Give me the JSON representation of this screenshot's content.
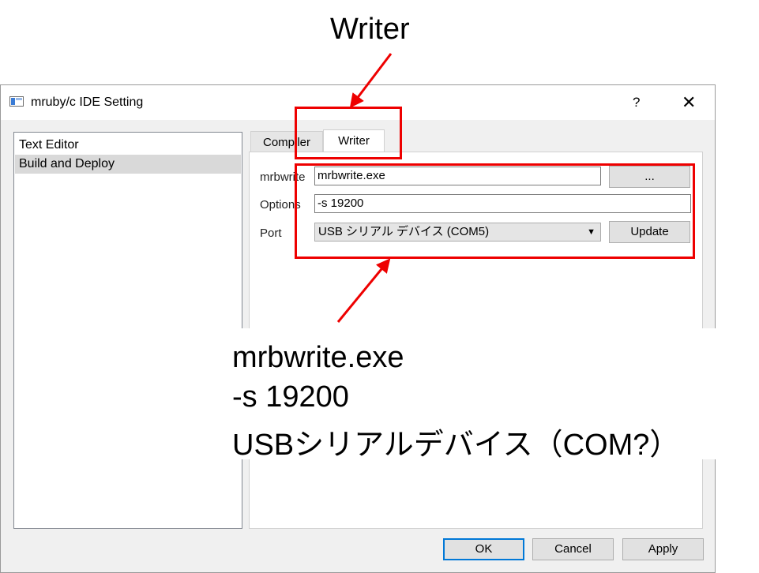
{
  "annotation": {
    "title": "Writer",
    "lines": [
      "mrbwrite.exe",
      "-s 19200",
      "USBシリアルデバイス（COM?）"
    ],
    "highlight_color": "#ee0000"
  },
  "window": {
    "title": "mruby/c IDE Setting",
    "help": "?",
    "close": "✕"
  },
  "nav": {
    "items": [
      "Text Editor",
      "Build and Deploy"
    ],
    "selected_index": 1
  },
  "tabs": {
    "compiler": "Compiler",
    "writer": "Writer",
    "active": "Writer"
  },
  "writer": {
    "mrbwrite_label": "mrbwrite",
    "mrbwrite_value": "mrbwrite.exe",
    "browse_label": "...",
    "options_label": "Options",
    "options_value": "-s 19200",
    "port_label": "Port",
    "port_value": "USB シリアル デバイス (COM5)",
    "update_label": "Update"
  },
  "footer": {
    "ok": "OK",
    "cancel": "Cancel",
    "apply": "Apply"
  },
  "colors": {
    "accent": "#0078d7",
    "selection": "#d9d9d9"
  }
}
